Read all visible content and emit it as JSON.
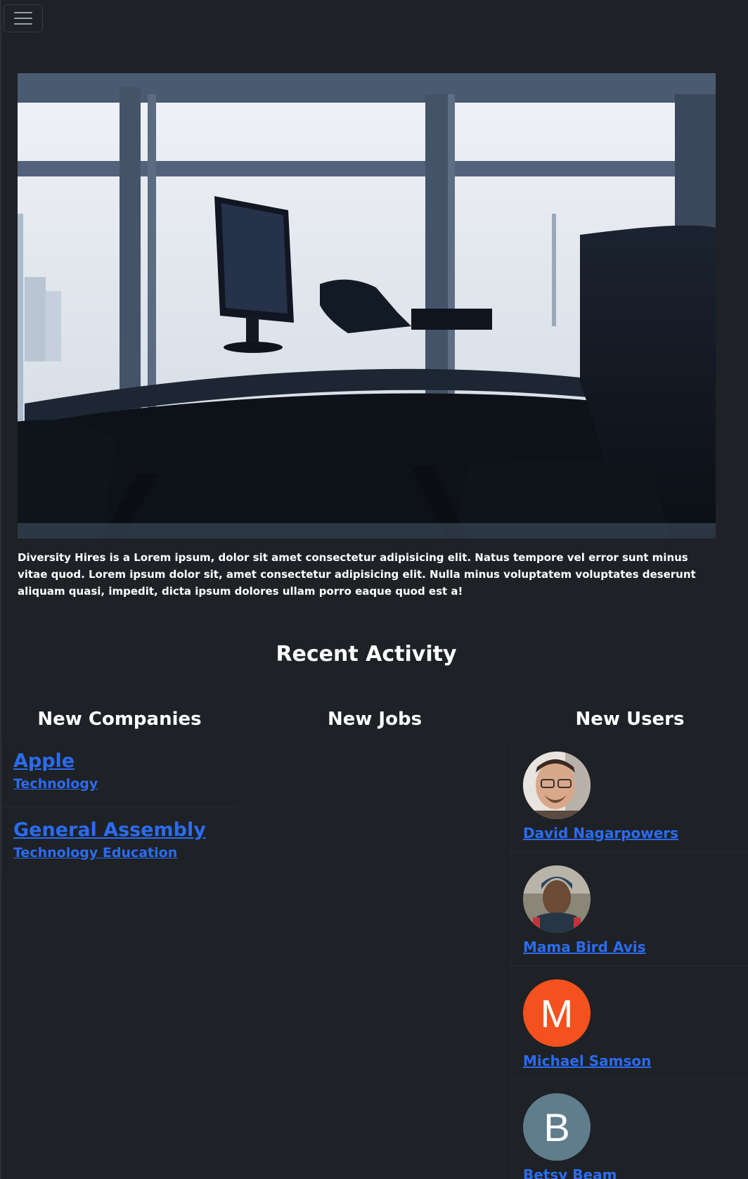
{
  "navbar": {
    "toggle_icon": "hamburger-icon"
  },
  "hero": {
    "image_label": "office-desk-photo"
  },
  "intro": {
    "text": "Diversity Hires is a Lorem ipsum, dolor sit amet consectetur adipisicing elit. Natus tempore vel error sunt minus vitae quod. Lorem ipsum dolor sit, amet consectetur adipisicing elit. Nulla minus voluptatem voluptates deserunt aliquam quasi, impedit, dicta ipsum dolores ullam porro eaque quod est a!"
  },
  "recent_activity": {
    "title": "Recent Activity",
    "companies": {
      "title": "New Companies",
      "items": [
        {
          "name": "Apple",
          "industry": "Technology"
        },
        {
          "name": "General Assembly",
          "industry": "Technology Education"
        }
      ]
    },
    "jobs": {
      "title": "New Jobs",
      "items": []
    },
    "users": {
      "title": "New Users",
      "items": [
        {
          "name": "David Nagarpowers",
          "avatar": "photo"
        },
        {
          "name": "Mama Bird Avis",
          "avatar": "photo"
        },
        {
          "name": "Michael Samson",
          "avatar": "M",
          "color": "#f4511e"
        },
        {
          "name": "Betsy Beam",
          "avatar": "B",
          "color": "#607d8b"
        }
      ]
    }
  },
  "colors": {
    "background": "#1e2125",
    "link": "#2b6cf0",
    "text": "#ffffff"
  }
}
